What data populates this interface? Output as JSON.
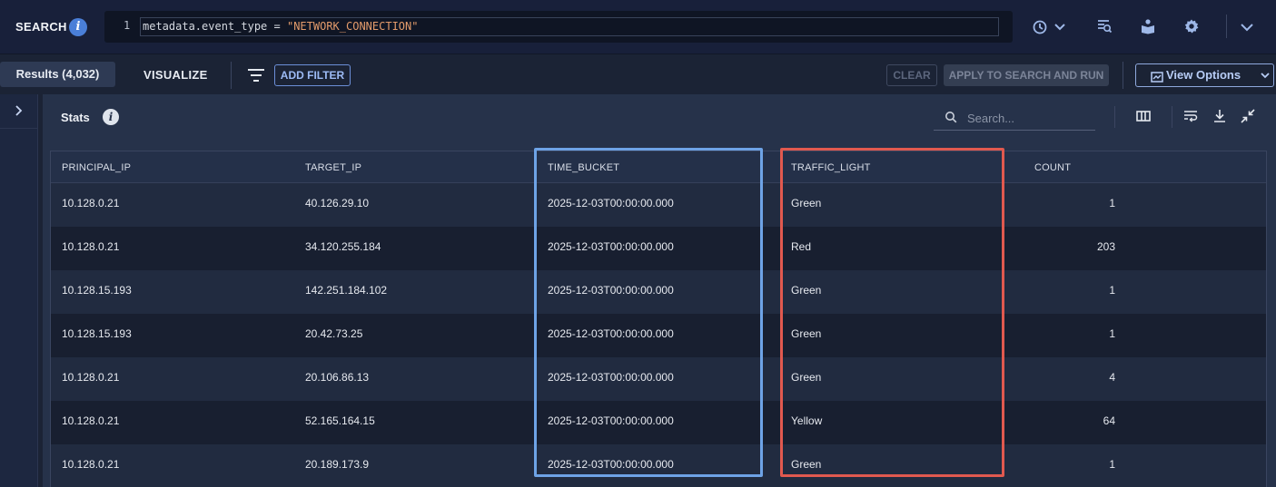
{
  "search": {
    "label": "SEARCH",
    "line_number": "1",
    "query_field": "metadata.event_type",
    "query_operator": " = ",
    "query_value": "\"NETWORK_CONNECTION\""
  },
  "tabs": {
    "results": "Results (4,032)",
    "visualize": "VISUALIZE"
  },
  "filters": {
    "add_filter": "ADD FILTER",
    "clear": "CLEAR",
    "apply": "APPLY TO SEARCH AND RUN",
    "view_options": "View Options"
  },
  "panel": {
    "title": "Stats",
    "search_placeholder": "Search..."
  },
  "table": {
    "columns": [
      "PRINCIPAL_IP",
      "TARGET_IP",
      "TIME_BUCKET",
      "TRAFFIC_LIGHT",
      "COUNT"
    ],
    "rows": [
      [
        "10.128.0.21",
        "40.126.29.10",
        "2025-12-03T00:00:00.000",
        "Green",
        "1"
      ],
      [
        "10.128.0.21",
        "34.120.255.184",
        "2025-12-03T00:00:00.000",
        "Red",
        "203"
      ],
      [
        "10.128.15.193",
        "142.251.184.102",
        "2025-12-03T00:00:00.000",
        "Green",
        "1"
      ],
      [
        "10.128.15.193",
        "20.42.73.25",
        "2025-12-03T00:00:00.000",
        "Green",
        "1"
      ],
      [
        "10.128.0.21",
        "20.106.86.13",
        "2025-12-03T00:00:00.000",
        "Green",
        "4"
      ],
      [
        "10.128.0.21",
        "52.165.164.15",
        "2025-12-03T00:00:00.000",
        "Yellow",
        "64"
      ],
      [
        "10.128.0.21",
        "20.189.173.9",
        "2025-12-03T00:00:00.000",
        "Green",
        "1"
      ]
    ]
  },
  "icons": {
    "info": "info-icon",
    "history": "history-icon",
    "chevron": "chevron-down-icon",
    "search_manager": "search-manager-icon",
    "guide": "guide-icon",
    "settings": "gear-icon",
    "filter": "filter-icon",
    "columns": "columns-icon",
    "wrap": "wrap-text-icon",
    "download": "download-icon",
    "collapse": "collapse-icon",
    "expand_rail": "chevron-right-icon"
  }
}
